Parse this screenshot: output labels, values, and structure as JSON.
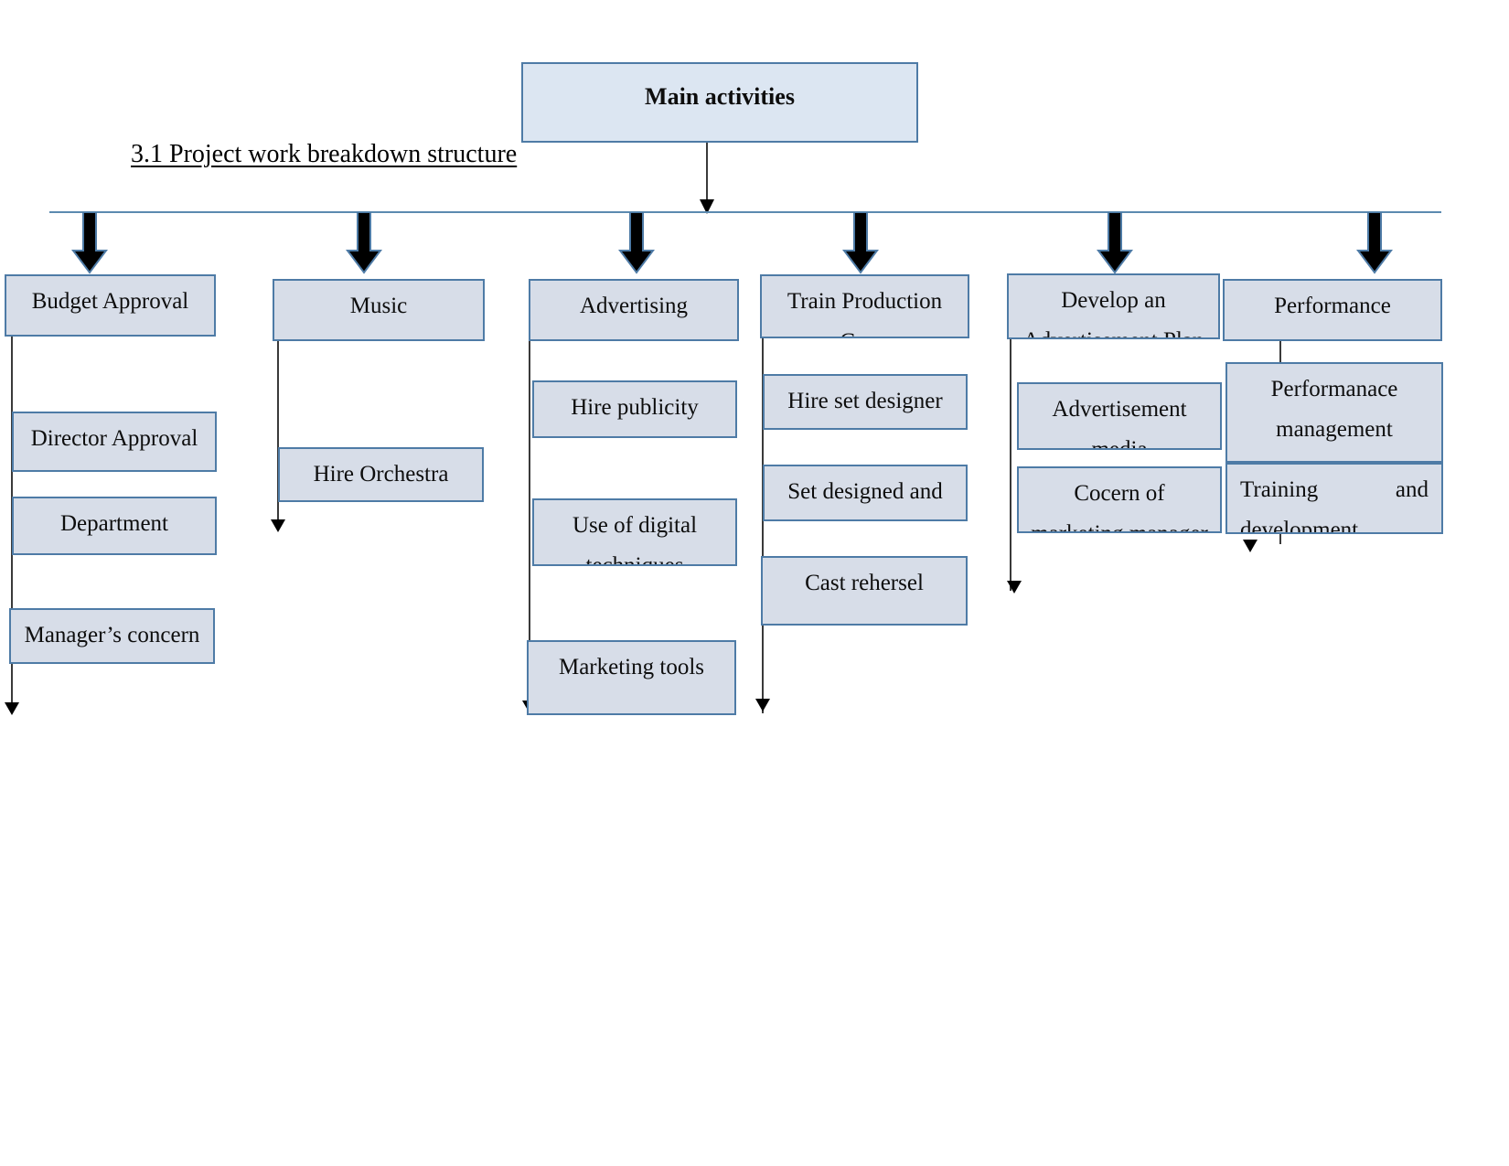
{
  "document": {
    "heading": "3.1 Project work breakdown structure"
  },
  "diagram": {
    "type": "work-breakdown-structure",
    "colors": {
      "box_fill": "#d7dde8",
      "box_fill_root": "#dce6f2",
      "box_border": "#4e7ba6",
      "connector": "#3a3a3a",
      "spine": "#5b8ab0",
      "arrow_fill": "#000000"
    },
    "root": {
      "label": "Main activities"
    },
    "branches": [
      {
        "label": "Budget Approval",
        "children": [
          {
            "label": "Director Approval"
          },
          {
            "label": "Department approval"
          },
          {
            "label": "Manager’s concern"
          }
        ]
      },
      {
        "label": "Music",
        "children": [
          {
            "label": "Hire Orchestra"
          }
        ]
      },
      {
        "label": "Advertising",
        "children": [
          {
            "label": "Hire publicity Director"
          },
          {
            "label": "Use of digital techniques"
          },
          {
            "label": "Marketing tools"
          }
        ]
      },
      {
        "label": "Train Production Crew",
        "children": [
          {
            "label": "Hire set designer"
          },
          {
            "label": "Set designed and built"
          },
          {
            "label": "Cast rehersel"
          }
        ]
      },
      {
        "label": "Develop an Advertisement Plan",
        "children": [
          {
            "label": "Advertisement media"
          },
          {
            "label": "Cocern of marketing manager"
          }
        ]
      },
      {
        "label": "Performance",
        "children": [
          {
            "label": "Performanace management"
          },
          {
            "label": "Training and development"
          }
        ]
      }
    ]
  }
}
